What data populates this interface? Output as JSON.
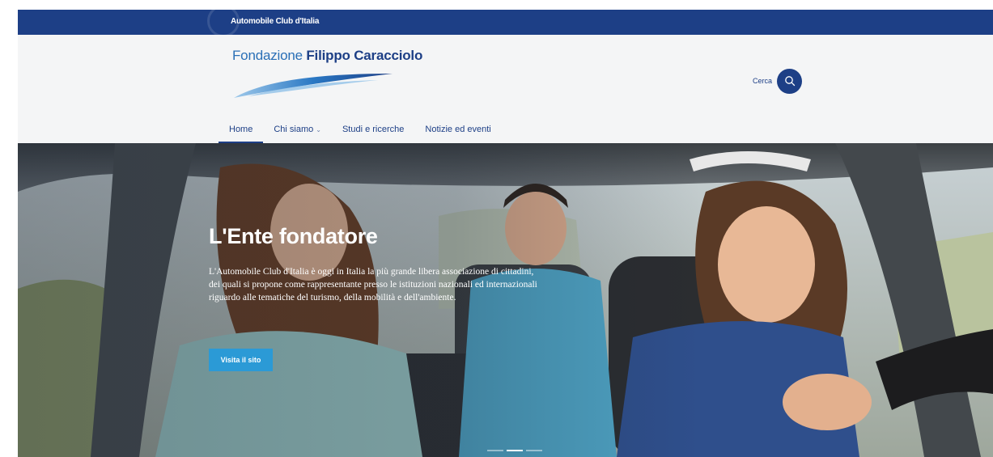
{
  "topbar": {
    "label": "Automobile Club d'Italia"
  },
  "header": {
    "logo": {
      "prefix": "Fondazione",
      "name": "Filippo Caracciolo"
    },
    "search": {
      "label": "Cerca",
      "icon": "search-icon"
    },
    "nav": [
      {
        "label": "Home",
        "active": true
      },
      {
        "label": "Chi siamo",
        "has_dropdown": true
      },
      {
        "label": "Studi e ricerche"
      },
      {
        "label": "Notizie ed eventi"
      }
    ]
  },
  "hero": {
    "title": "L'Ente fondatore",
    "body": "L'Automobile Club d'Italia è oggi in Italia la più grande libera associazione di cittadini, dei quali si propone come rappresentante presso le istituzioni nazionali ed internazionali riguardo alle tematiche del turismo, della mobilità e dell'ambiente.",
    "button_label": "Visita il sito",
    "slides": {
      "count": 3,
      "active": 2
    }
  },
  "colors": {
    "brand_blue": "#1d3f86",
    "accent_blue": "#2b9ad6",
    "header_bg": "#f4f5f6"
  }
}
